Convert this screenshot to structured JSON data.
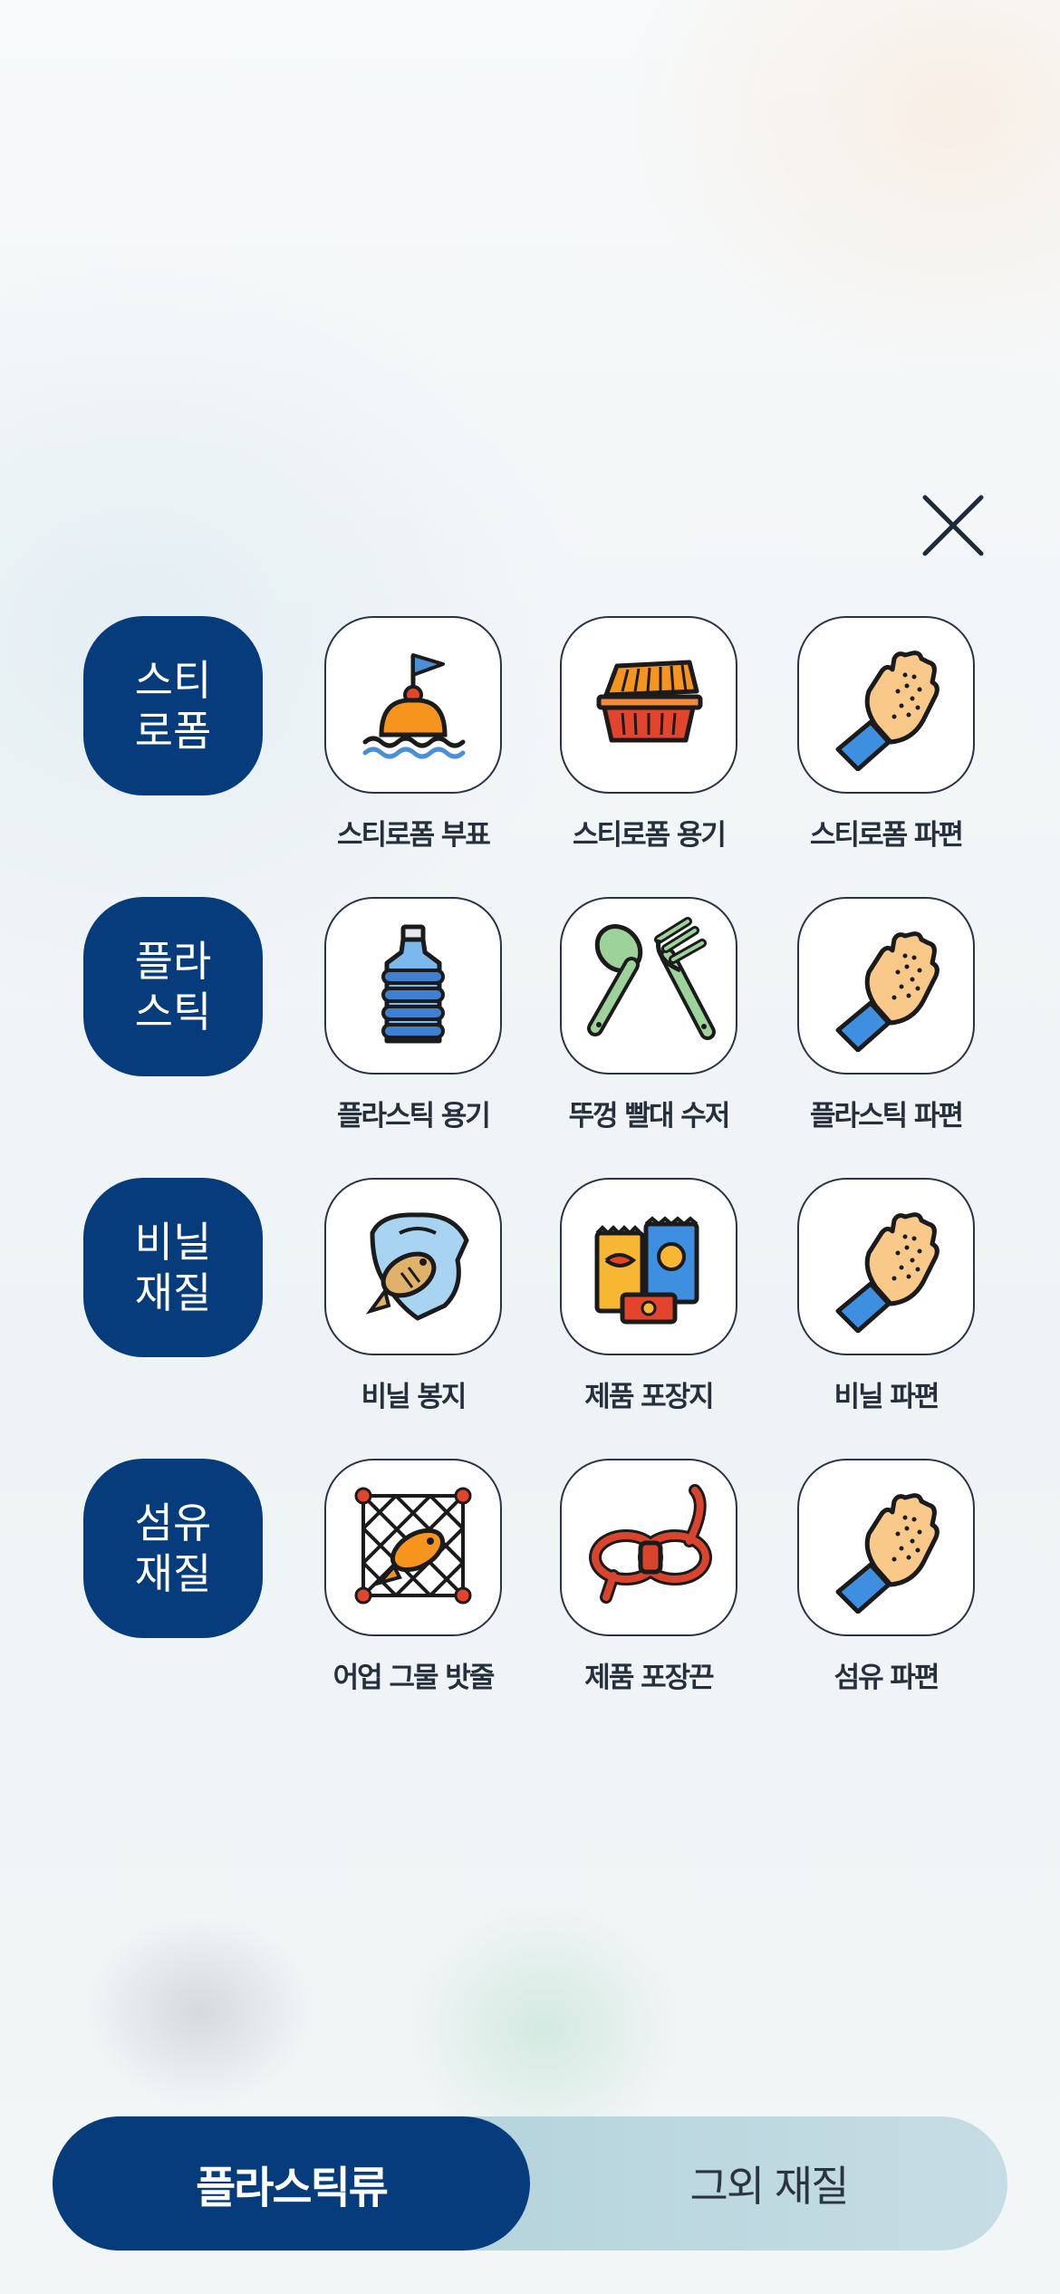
{
  "close": {
    "icon": "close-icon"
  },
  "categories": [
    {
      "label": "스티\n로폼",
      "items": [
        {
          "label": "스티로폼 부표",
          "icon": "buoy-icon"
        },
        {
          "label": "스티로폼 용기",
          "icon": "takeout-container-icon"
        },
        {
          "label": "스티로폼 파편",
          "icon": "fragments-hand-icon"
        }
      ]
    },
    {
      "label": "플라\n스틱",
      "items": [
        {
          "label": "플라스틱 용기",
          "icon": "water-bottle-icon"
        },
        {
          "label": "뚜껑 빨대 수저",
          "icon": "spoon-fork-icon"
        },
        {
          "label": "플라스틱 파편",
          "icon": "fragments-hand-icon"
        }
      ]
    },
    {
      "label": "비닐\n재질",
      "items": [
        {
          "label": "비닐 봉지",
          "icon": "plastic-bag-fish-icon"
        },
        {
          "label": "제품 포장지",
          "icon": "snack-wrappers-icon"
        },
        {
          "label": "비닐 파편",
          "icon": "fragments-hand-icon"
        }
      ]
    },
    {
      "label": "섬유\n재질",
      "items": [
        {
          "label": "어업 그물 밧줄",
          "icon": "fishing-net-icon"
        },
        {
          "label": "제품 포장끈",
          "icon": "rope-coil-icon"
        },
        {
          "label": "섬유 파편",
          "icon": "fragments-hand-icon"
        }
      ]
    }
  ],
  "segment": {
    "active_label": "플라스틱류",
    "other_label": "그외 재질"
  },
  "colors": {
    "primary": "#073c7c",
    "tile_border": "#2a3446"
  }
}
